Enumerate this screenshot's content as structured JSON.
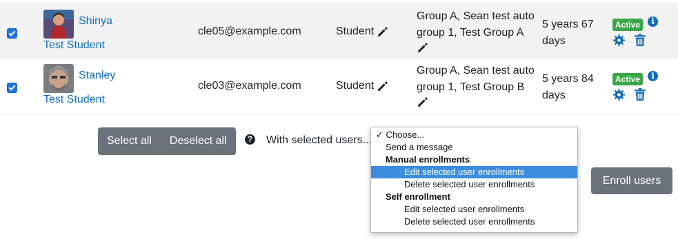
{
  "rows": [
    {
      "first_name": "Shinya",
      "last_name": "Test Student",
      "email": "cle05@example.com",
      "role": "Student",
      "groups": "Group A, Sean test auto group 1, Test Group A",
      "enrolled_since": "5 years 67 days",
      "status": "Active",
      "checked": true
    },
    {
      "first_name": "Stanley",
      "last_name": "Test Student",
      "email": "cle03@example.com",
      "role": "Student",
      "groups": "Group A, Sean test auto group 1, Test Group B",
      "enrolled_since": "5 years 84 days",
      "status": "Active",
      "checked": true
    }
  ],
  "bulk": {
    "select_all": "Select all",
    "deselect_all": "Deselect all",
    "with_selected": "With selected users...",
    "options": [
      {
        "label": "Choose...",
        "type": "option",
        "checked": true
      },
      {
        "label": "Send a message",
        "type": "option"
      },
      {
        "label": "Manual enrollments",
        "type": "group"
      },
      {
        "label": "Edit selected user enrollments",
        "type": "suboption",
        "highlighted": true
      },
      {
        "label": "Delete selected user enrollments",
        "type": "suboption"
      },
      {
        "label": "Self enrollment",
        "type": "group"
      },
      {
        "label": "Edit selected user enrollments",
        "type": "suboption"
      },
      {
        "label": "Delete selected user enrollments",
        "type": "suboption"
      }
    ]
  },
  "enroll_button": "Enroll users",
  "colors": {
    "link": "#0f6cbf",
    "active_badge": "#3aa648",
    "button": "#6a737b",
    "highlight": "#3c8ddf"
  },
  "icons": {
    "edit": "pencil-icon",
    "info": "info-icon",
    "settings": "gear-icon",
    "delete": "trash-icon",
    "help": "question-icon",
    "checkmark": "check-icon"
  }
}
